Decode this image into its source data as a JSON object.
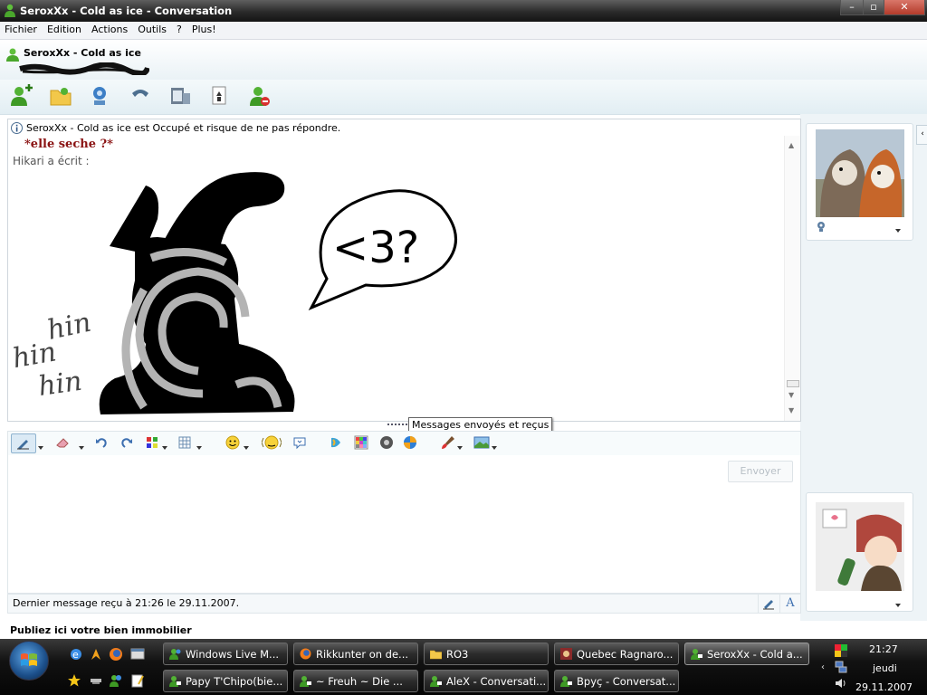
{
  "window": {
    "title": "SeroxXx - Cold as ice - Conversation"
  },
  "menu": [
    "Fichier",
    "Edition",
    "Actions",
    "Outils",
    "?",
    "Plus!"
  ],
  "contact": {
    "name": "SeroxXx - Cold as ice"
  },
  "notice": "SeroxXx - Cold as ice est Occupé et risque de ne pas répondre.",
  "history": {
    "message_bold": "*elle seche ?*",
    "quote_header": "Hikari a écrit :",
    "drawing_text": {
      "bubble": "<3?",
      "laugh": [
        "hin",
        "hin",
        "hin"
      ]
    }
  },
  "tooltip": "Messages envoyés et reçus",
  "compose": {
    "send_label": "Envoyer"
  },
  "last_message": "Dernier message reçu à 21:26 le 29.11.2007.",
  "ad": "Publiez ici votre bien immobilier",
  "taskbar": {
    "row1": [
      "Windows Live M...",
      "Rikkunter on de...",
      "RO3",
      "Quebec Ragnaro...",
      "SeroxXx - Cold a..."
    ],
    "row2": [
      "Papy T'Chipo(bie...",
      "~ Freuh ~   Die ...",
      "AleX - Conversati...",
      "Bpyç - Conversat..."
    ]
  },
  "clock": {
    "time": "21:27",
    "day": "jeudi",
    "date": "29.11.2007"
  }
}
